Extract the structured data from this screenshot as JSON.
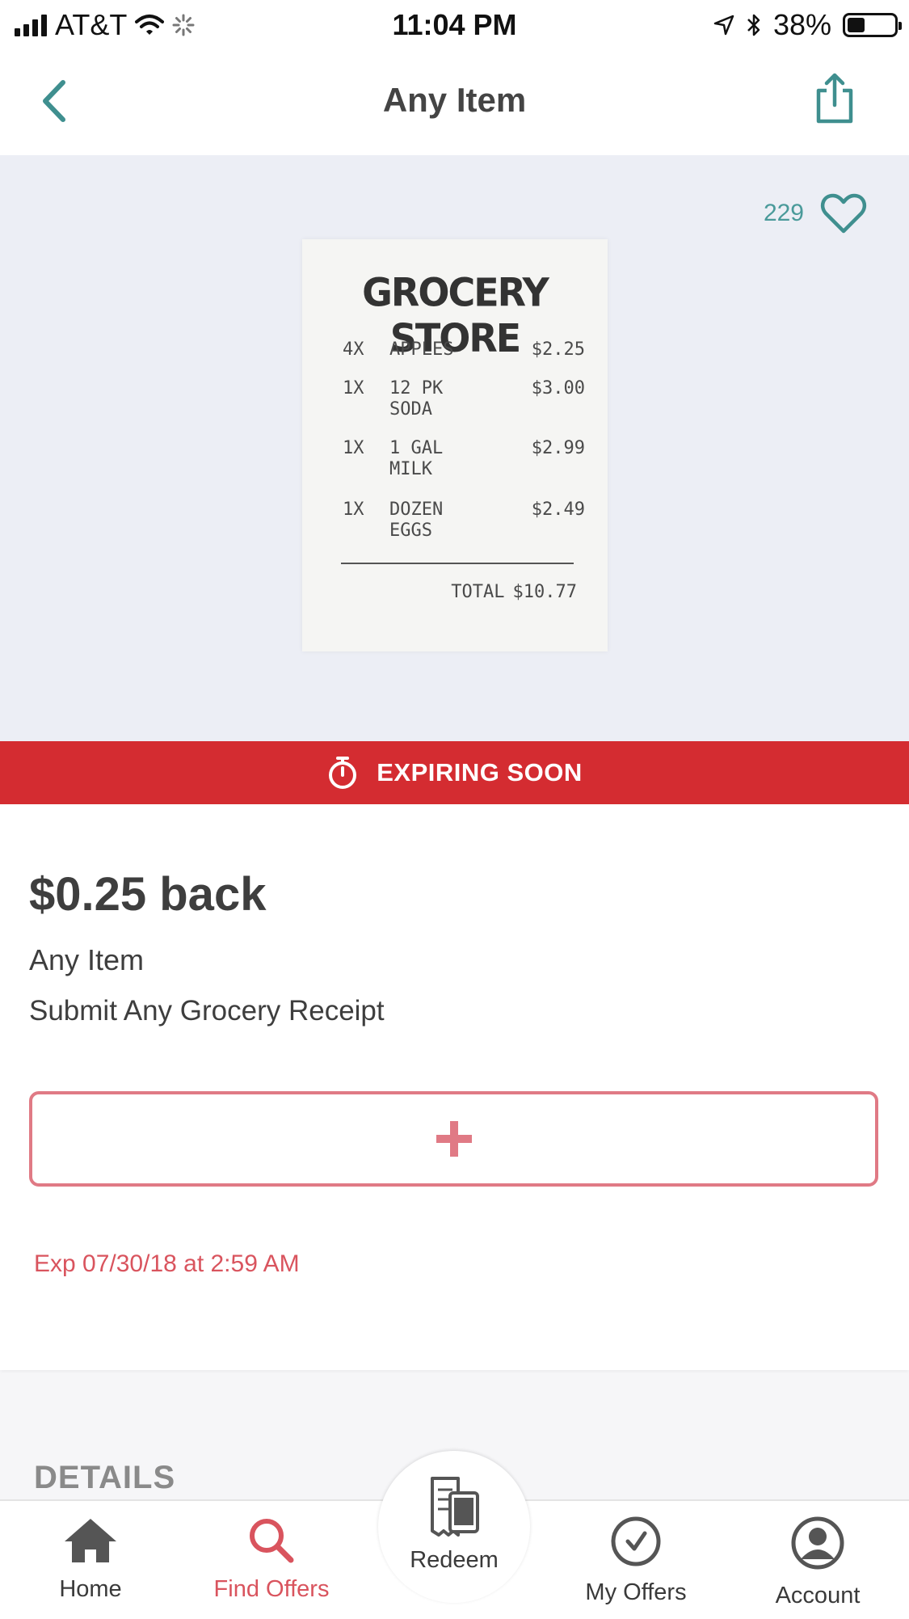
{
  "status": {
    "carrier": "AT&T",
    "time": "11:04 PM",
    "battery": "38%",
    "battery_level": 0.38
  },
  "nav": {
    "title": "Any Item"
  },
  "hero": {
    "like_count": "229",
    "receipt": {
      "title": "GROCERY STORE",
      "rows": [
        {
          "qty": "4X",
          "item": "APPLES",
          "price": "$2.25"
        },
        {
          "qty": "1X",
          "item": "12 PK SODA",
          "price": "$3.00"
        },
        {
          "qty": "1X",
          "item": "1 GAL MILK",
          "price": "$2.99"
        },
        {
          "qty": "1X",
          "item": "DOZEN EGGS",
          "price": "$2.49"
        }
      ],
      "total_label": "TOTAL",
      "total_value": "$10.77"
    }
  },
  "banner": {
    "text": "EXPIRING SOON",
    "color": "#d42c31"
  },
  "offer": {
    "amount": "$0.25 back",
    "name": "Any Item",
    "description": "Submit Any Grocery Receipt",
    "add_symbol": "+",
    "expiry": "Exp 07/30/18 at 2:59 AM"
  },
  "details": {
    "heading": "DETAILS"
  },
  "tabs": [
    {
      "label": "Home",
      "icon": "home-icon"
    },
    {
      "label": "Find Offers",
      "icon": "search-icon"
    },
    {
      "label": "Redeem",
      "icon": "receipt-icon"
    },
    {
      "label": "My Offers",
      "icon": "checkmark-circle-icon"
    },
    {
      "label": "Account",
      "icon": "account-icon"
    }
  ],
  "colors": {
    "accent_teal": "#3f8f8f",
    "accent_red": "#d9545e",
    "button_border": "#e07a85"
  }
}
